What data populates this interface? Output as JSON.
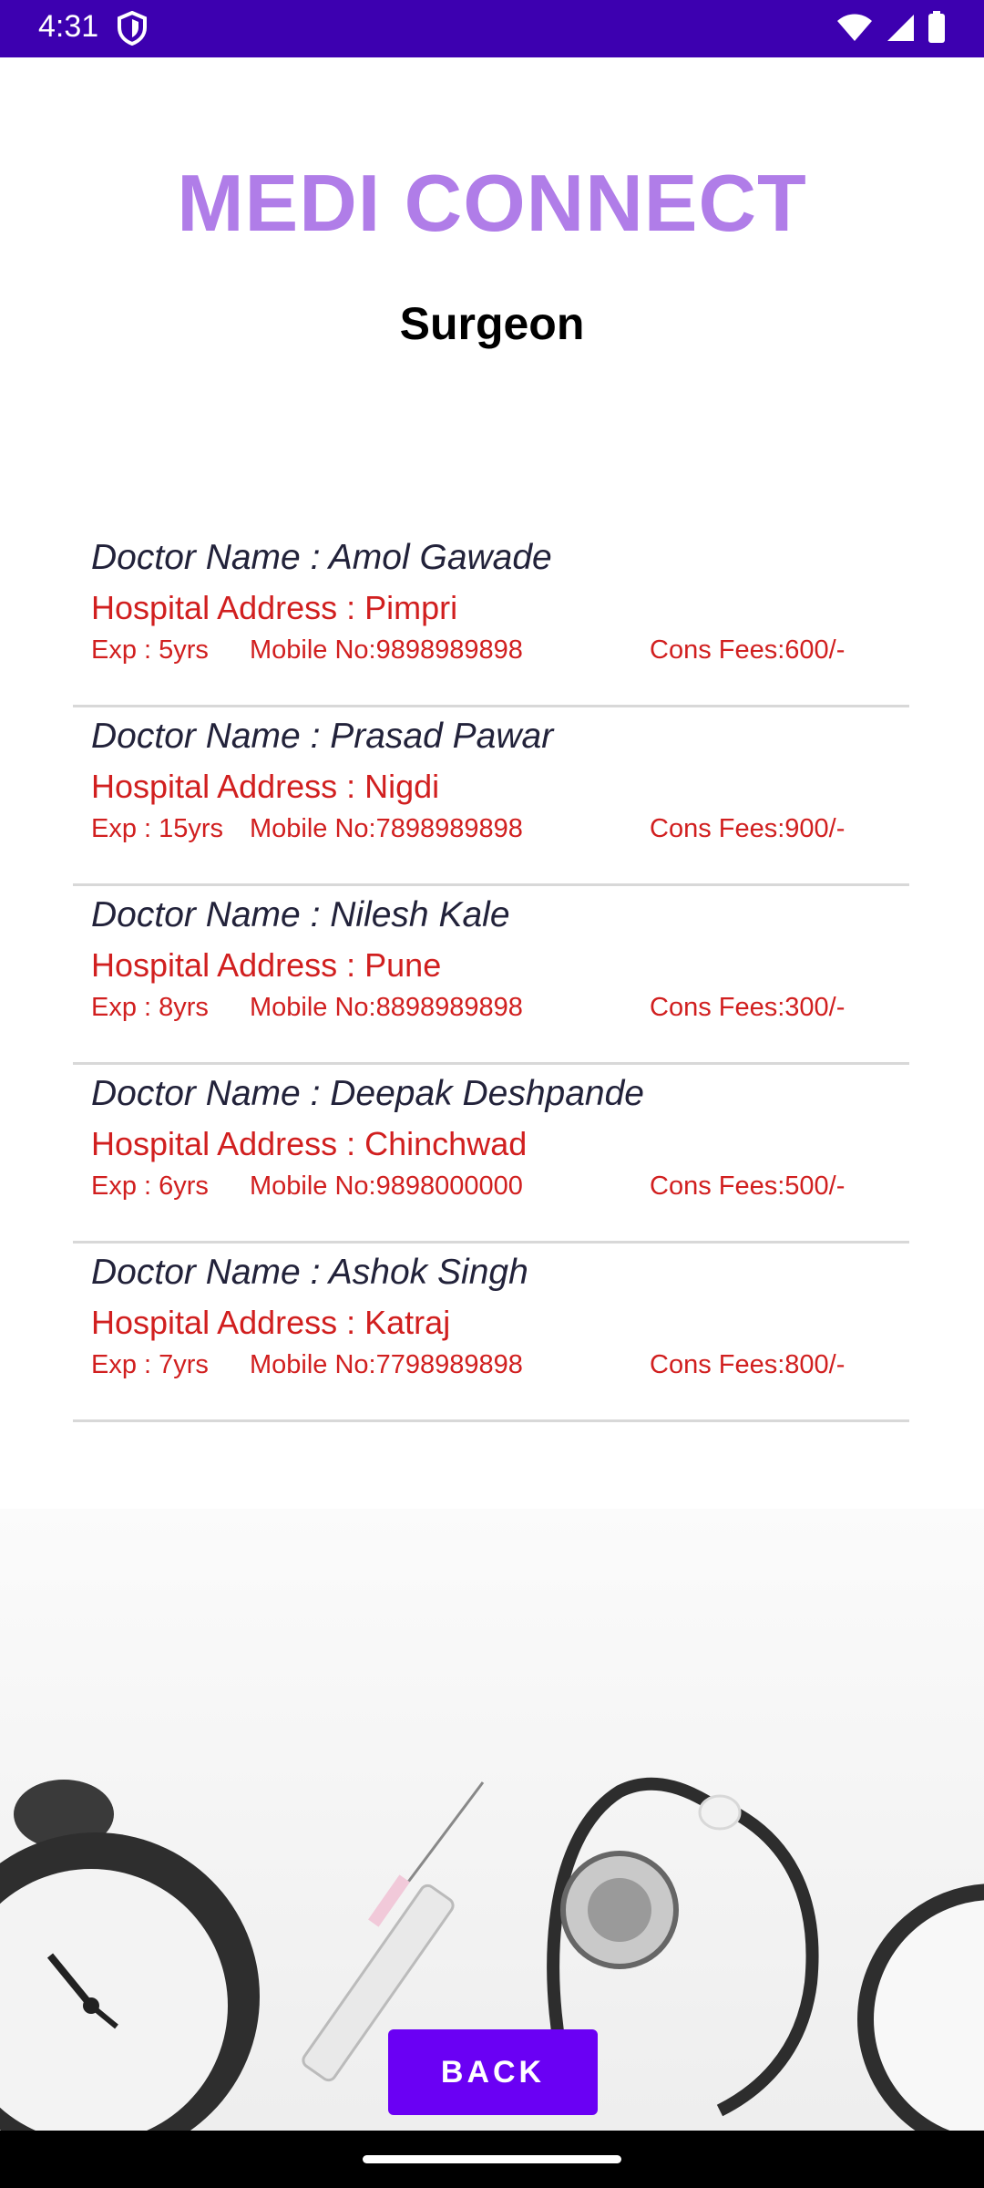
{
  "status_bar": {
    "time": "4:31"
  },
  "app": {
    "title": "MEDI CONNECT",
    "subtitle": "Surgeon"
  },
  "doctors": [
    {
      "name": "Doctor Name : Amol Gawade",
      "address": "Hospital Address : Pimpri",
      "exp": "Exp : 5yrs",
      "mobile": "Mobile No:9898989898",
      "fees": "Cons Fees:600/-"
    },
    {
      "name": "Doctor Name : Prasad Pawar",
      "address": "Hospital Address : Nigdi",
      "exp": "Exp : 15yrs",
      "mobile": "Mobile No:7898989898",
      "fees": "Cons Fees:900/-"
    },
    {
      "name": "Doctor Name : Nilesh Kale",
      "address": "Hospital Address : Pune",
      "exp": "Exp : 8yrs",
      "mobile": "Mobile No:8898989898",
      "fees": "Cons Fees:300/-"
    },
    {
      "name": "Doctor Name : Deepak Deshpande",
      "address": "Hospital Address : Chinchwad",
      "exp": "Exp : 6yrs",
      "mobile": "Mobile No:9898000000",
      "fees": "Cons Fees:500/-"
    },
    {
      "name": "Doctor Name : Ashok Singh",
      "address": "Hospital Address : Katraj",
      "exp": "Exp : 7yrs",
      "mobile": "Mobile No:7798989898",
      "fees": "Cons Fees:800/-"
    }
  ],
  "actions": {
    "back_label": "BACK"
  },
  "colors": {
    "status_bar": "#3d00b0",
    "title": "#b07de8",
    "detail_text": "#d11f1f",
    "button": "#6a00f4"
  }
}
